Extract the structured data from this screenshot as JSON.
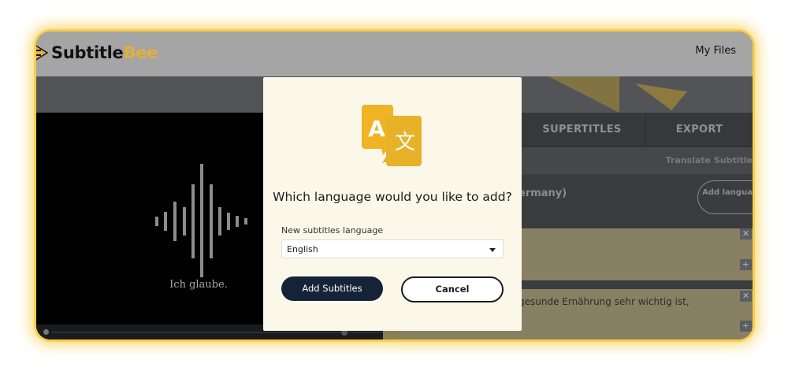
{
  "app": {
    "logo_text_primary": "Subtitle",
    "logo_text_secondary": "Bee",
    "nav_my_files": "My Files"
  },
  "colors": {
    "accent": "#e8b22a",
    "primary_button": "#152339",
    "modal_bg": "#fbf8e9"
  },
  "video": {
    "caption": "Ich glaube."
  },
  "panel": {
    "tabs": [
      {
        "label": "SUPERTITLES"
      },
      {
        "label": "EXPORT"
      }
    ],
    "translate_label": "Translate Subtitle",
    "language_name_fragment": "ermany)",
    "add_language_button": "Add language",
    "cue_text_fragment": "gesunde Ernährung sehr wichtig ist,"
  },
  "modal": {
    "icon": "translate-icon",
    "title": "Which language would you like to add?",
    "field_label": "New subtitles language",
    "selected_language": "English",
    "primary_button": "Add Subtitles",
    "cancel_button": "Cancel"
  }
}
